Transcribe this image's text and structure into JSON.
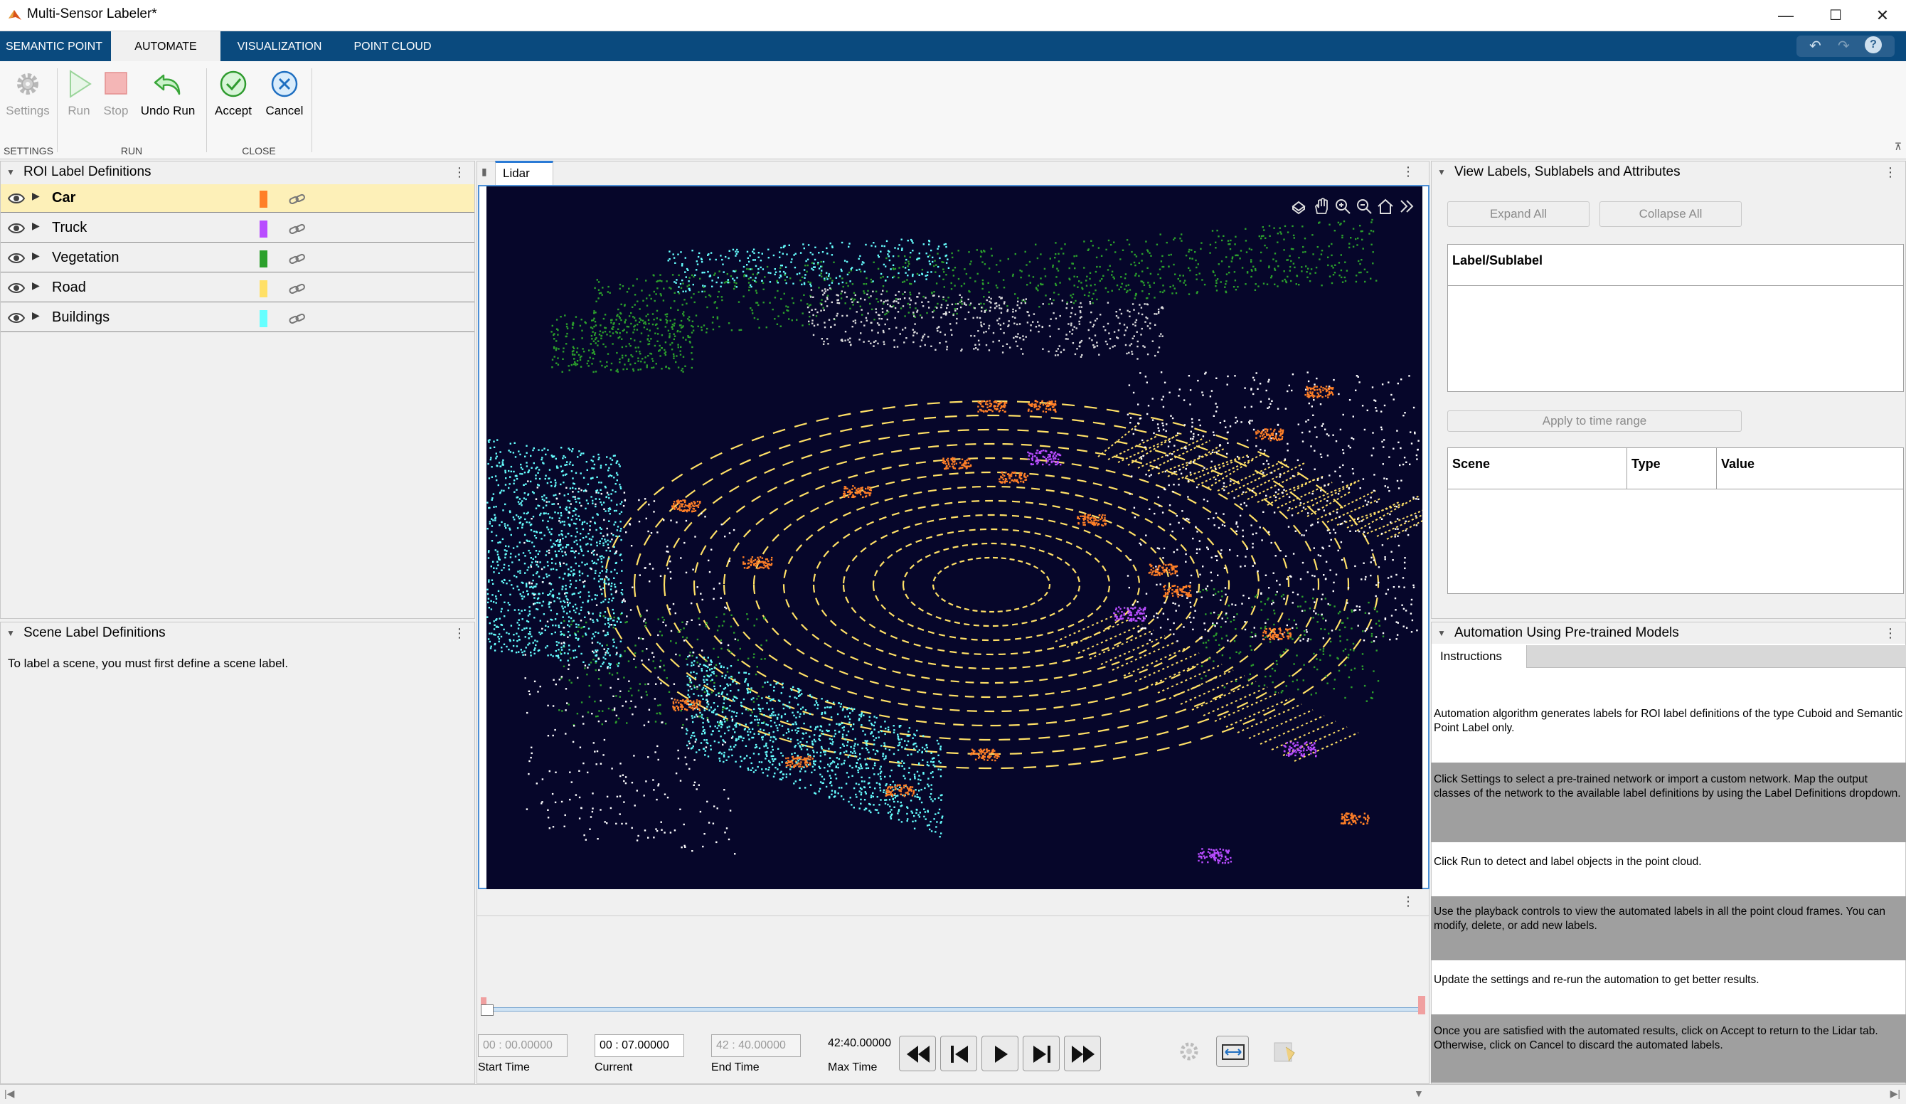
{
  "window": {
    "title": "Multi-Sensor Labeler*",
    "minimize": "—",
    "maximize": "☐",
    "close": "✕"
  },
  "tabs": [
    {
      "label": "SEMANTIC POINT"
    },
    {
      "label": "AUTOMATE"
    },
    {
      "label": "VISUALIZATION"
    },
    {
      "label": "POINT CLOUD"
    }
  ],
  "toolstrip": {
    "settings": "Settings",
    "run": "Run",
    "stop": "Stop",
    "undo_run": "Undo Run",
    "accept": "Accept",
    "cancel": "Cancel",
    "sections": {
      "settings": "SETTINGS",
      "run": "RUN",
      "close": "CLOSE"
    }
  },
  "roi_panel": {
    "title": "ROI Label Definitions",
    "labels": [
      {
        "name": "Car",
        "color": "#ff7f27"
      },
      {
        "name": "Truck",
        "color": "#b84cff"
      },
      {
        "name": "Vegetation",
        "color": "#2ca02c"
      },
      {
        "name": "Road",
        "color": "#ffe066"
      },
      {
        "name": "Buildings",
        "color": "#66ffff"
      }
    ]
  },
  "scene_panel": {
    "title": "Scene Label Definitions",
    "message": "To label a scene, you must first define a scene label."
  },
  "lidar": {
    "tab": "Lidar"
  },
  "view_labels": {
    "title": "View Labels, Sublabels and Attributes",
    "expand_all": "Expand All",
    "collapse_all": "Collapse All",
    "label_header": "Label/Sublabel",
    "apply_time_range": "Apply to time range",
    "scene_col": "Scene",
    "type_col": "Type",
    "value_col": "Value"
  },
  "automation": {
    "title": "Automation Using Pre-trained Models",
    "tab": "Instructions",
    "steps": [
      "Automation algorithm generates labels for ROI label definitions of the type Cuboid and Semantic Point Label only.",
      "Click Settings to select a pre-trained network or import a custom network. Map the output classes of the network to the available label definitions by using the Label Definitions dropdown.",
      "Click Run to detect and label objects in the point cloud.",
      "Use the playback controls to view the automated labels in all the point cloud frames. You can modify, delete, or add new labels.",
      "Update the settings and re-run the automation to get better results.",
      "Once you are satisfied with the automated results, click on Accept to return to the Lidar tab. Otherwise, click on Cancel to discard the automated labels."
    ]
  },
  "playback": {
    "start_time": "00 : 00.00000",
    "current": "00 : 07.00000",
    "end_time": "42 : 40.00000",
    "max_time": "42:40.00000",
    "start_label": "Start Time",
    "current_label": "Current",
    "end_label": "End Time",
    "max_label": "Max Time"
  }
}
